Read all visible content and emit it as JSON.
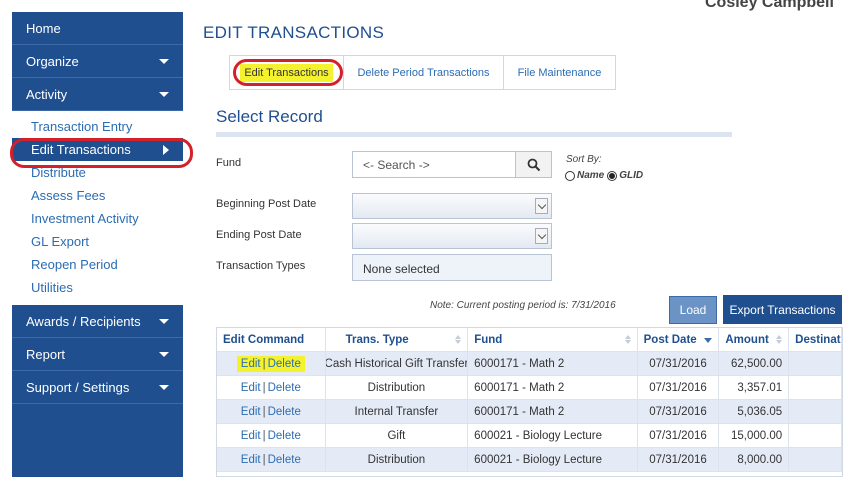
{
  "user": {
    "name": "Cosley Campbell"
  },
  "sidebar": {
    "top_items": [
      {
        "label": "Home"
      },
      {
        "label": "Organize"
      },
      {
        "label": "Activity"
      }
    ],
    "activity_subitems": [
      {
        "label": "Transaction Entry"
      },
      {
        "label": "Edit Transactions"
      },
      {
        "label": "Distribute"
      },
      {
        "label": "Assess Fees"
      },
      {
        "label": "Investment Activity"
      },
      {
        "label": "GL Export"
      },
      {
        "label": "Reopen Period"
      },
      {
        "label": "Utilities"
      }
    ],
    "bottom_items": [
      {
        "label": "Awards / Recipients"
      },
      {
        "label": "Report"
      },
      {
        "label": "Support / Settings"
      }
    ]
  },
  "page": {
    "title": "EDIT TRANSACTIONS"
  },
  "tabs": [
    {
      "label": "Edit Transactions"
    },
    {
      "label": "Delete Period Transactions"
    },
    {
      "label": "File Maintenance"
    }
  ],
  "form": {
    "section_title": "Select Record",
    "fund_label": "Fund",
    "fund_placeholder": "<- Search ->",
    "sort_by_label": "Sort By:",
    "sort_options": [
      {
        "label": "Name",
        "selected": false
      },
      {
        "label": "GLID",
        "selected": true
      }
    ],
    "begin_date_label": "Beginning Post Date",
    "end_date_label": "Ending Post Date",
    "types_label": "Transaction Types",
    "types_value": "None selected",
    "note": "Note: Current posting period is: 7/31/2016",
    "load_label": "Load",
    "export_label": "Export Transactions"
  },
  "table": {
    "headers": [
      "Edit Command",
      "Trans. Type",
      "Fund",
      "Post Date",
      "Amount",
      "Destinat"
    ],
    "edit_label": "Edit",
    "delete_label": "Delete",
    "rows": [
      {
        "type": "Cash Historical Gift Transfer",
        "fund": "6000171 - Math 2",
        "date": "07/31/2016",
        "amount": "62,500.00"
      },
      {
        "type": "Distribution",
        "fund": "6000171 - Math 2",
        "date": "07/31/2016",
        "amount": "3,357.01"
      },
      {
        "type": "Internal Transfer",
        "fund": "6000171 - Math 2",
        "date": "07/31/2016",
        "amount": "5,036.05"
      },
      {
        "type": "Gift",
        "fund": "600021 - Biology Lecture",
        "date": "07/31/2016",
        "amount": "15,000.00"
      },
      {
        "type": "Distribution",
        "fund": "600021 - Biology Lecture",
        "date": "07/31/2016",
        "amount": "8,000.00"
      }
    ]
  },
  "colors": {
    "nav_bg": "#1f4f8e",
    "highlight": "#f4f22e",
    "annotation_red": "#d4202b",
    "link": "#2b6cb3"
  }
}
